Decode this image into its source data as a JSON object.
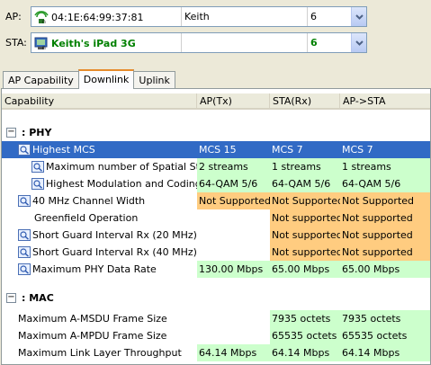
{
  "ap": {
    "label": "AP:",
    "mac": "04:1E:64:99:37:81",
    "name": "Keith",
    "channel": "6"
  },
  "sta": {
    "label": "STA:",
    "name": "Keith's iPad 3G",
    "col2": "",
    "channel": "6"
  },
  "tabs": [
    "AP Capability",
    "Downlink",
    "Uplink"
  ],
  "active_tab": "Downlink",
  "columns": [
    "Capability",
    "AP(Tx)",
    "STA(Rx)",
    "AP->STA"
  ],
  "groups": [
    {
      "title": ": PHY",
      "expanded": "−"
    },
    {
      "title": ": MAC",
      "expanded": "−"
    }
  ],
  "phy_rows": [
    {
      "cap": "Highest MCS",
      "ap": "MCS 15",
      "sta": "MCS 7",
      "apsta": "MCS 7"
    },
    {
      "cap": "Maximum number of Spatial Str...",
      "ap": "2 streams",
      "sta": "1 streams",
      "apsta": "1 streams"
    },
    {
      "cap": "Highest Modulation and Coding ...",
      "ap": "64-QAM 5/6",
      "sta": "64-QAM 5/6",
      "apsta": "64-QAM 5/6"
    },
    {
      "cap": "40 MHz Channel Width",
      "ap": "Not Supported",
      "sta": "Not Supported",
      "apsta": "Not Supported"
    },
    {
      "cap": "Greenfield Operation",
      "ap": "",
      "sta": "Not supported",
      "apsta": "Not supported"
    },
    {
      "cap": "Short Guard Interval Rx (20 MHz)",
      "ap": "",
      "sta": "Not supported",
      "apsta": "Not supported"
    },
    {
      "cap": "Short Guard Interval Rx (40 MHz)",
      "ap": "",
      "sta": "Not supported",
      "apsta": "Not supported"
    },
    {
      "cap": "Maximum PHY Data Rate",
      "ap": "130.00 Mbps",
      "sta": "65.00 Mbps",
      "apsta": "65.00 Mbps"
    }
  ],
  "mac_rows": [
    {
      "cap": "Maximum A-MSDU Frame Size",
      "ap": "",
      "sta": "7935 octets",
      "apsta": "7935 octets"
    },
    {
      "cap": "Maximum A-MPDU Frame Size",
      "ap": "",
      "sta": "65535 octets",
      "apsta": "65535 octets"
    },
    {
      "cap": "Maximum Link Layer Throughput",
      "ap": "64.14 Mbps",
      "sta": "64.14 Mbps",
      "apsta": "64.14 Mbps"
    }
  ],
  "colors": {
    "green": "#ccffcc",
    "orange": "#ffcc80",
    "selected": "#316ac5"
  }
}
